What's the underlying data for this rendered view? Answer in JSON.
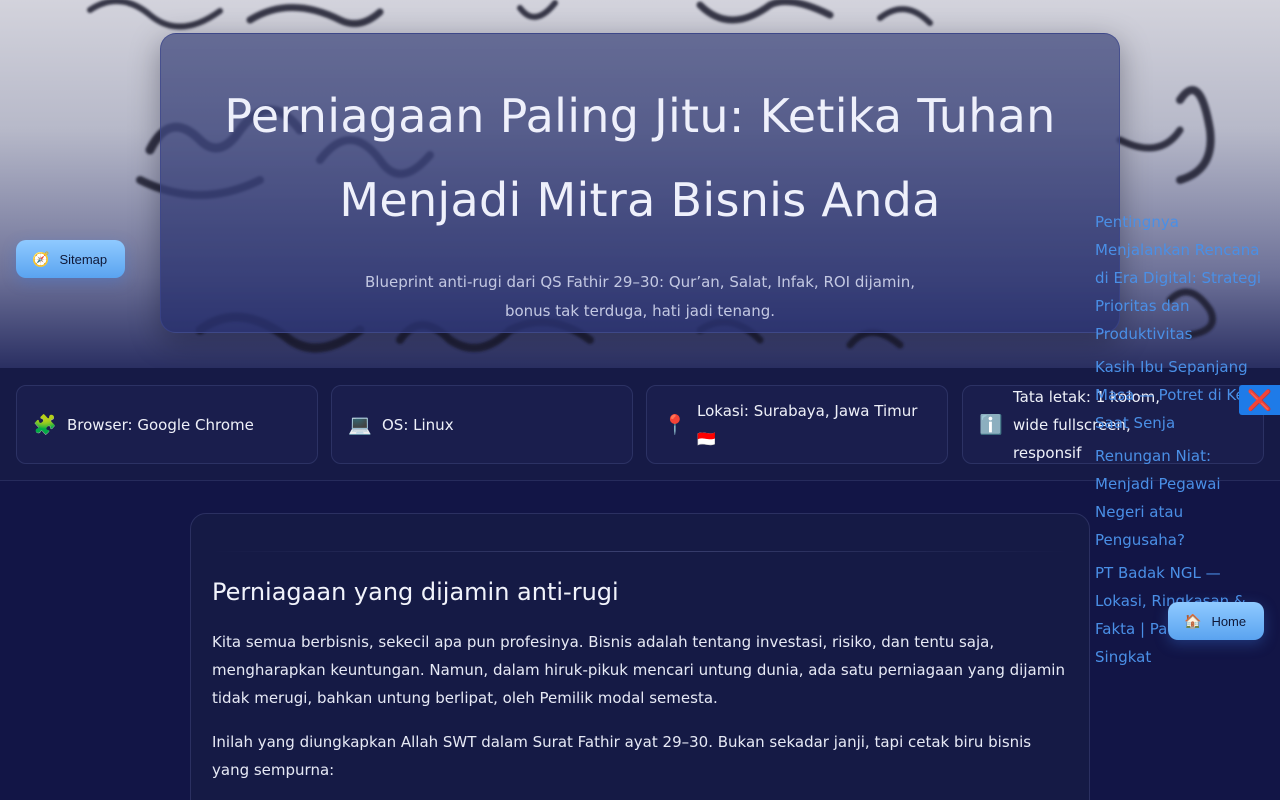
{
  "hero": {
    "title": "Perniagaan Paling Jitu: Ketika Tuhan Menjadi Mitra Bisnis Anda",
    "subtitle": "Blueprint anti-rugi dari QS Fathir 29–30: Qur’an, Salat, Infak, ROI dijamin, bonus tak terduga, hati jadi tenang."
  },
  "buttons": {
    "sitemap": {
      "icon": "🧭",
      "label": "Sitemap"
    },
    "home": {
      "icon": "🏠",
      "label": "Home"
    },
    "close": {
      "icon": "❌"
    }
  },
  "info_cards": [
    {
      "icon": "🧩",
      "text": "Browser: Google Chrome"
    },
    {
      "icon": "💻",
      "text": "OS: Linux"
    },
    {
      "icon": "📍",
      "text": "Lokasi: Surabaya, Jawa Timur 🇮🇩"
    },
    {
      "icon": "ℹ️",
      "text": "Tata letak: 1 kolom, wide fullscreen, responsif"
    }
  ],
  "article": {
    "heading": "Perniagaan yang dijamin anti-rugi",
    "paragraphs": [
      "Kita semua berbisnis, sekecil apa pun profesinya. Bisnis adalah tentang investasi, risiko, dan tentu saja, mengharapkan keuntungan. Namun, dalam hiruk-pikuk mencari untung dunia, ada satu perniagaan yang dijamin tidak merugi, bahkan untung berlipat, oleh Pemilik modal semesta.",
      "Inilah yang diungkapkan Allah SWT dalam Surat Fathir ayat 29–30. Bukan sekadar janji, tapi cetak biru bisnis yang sempurna:"
    ]
  },
  "related_links": [
    "Pentingnya Menjalankan Rencana di Era Digital: Strategi Prioritas dan Produktivitas",
    "Kasih Ibu Sepanjang Masa — Potret di Kediri Saat Senja",
    "Renungan Niat: Menjadi Pegawai Negeri atau Pengusaha?",
    "PT Badak NGL — Lokasi, Ringkasan & Fakta | Panduan Singkat"
  ],
  "colors": {
    "accent": "#5aa3f0",
    "link": "#4a8fe6",
    "background": "#121546"
  }
}
